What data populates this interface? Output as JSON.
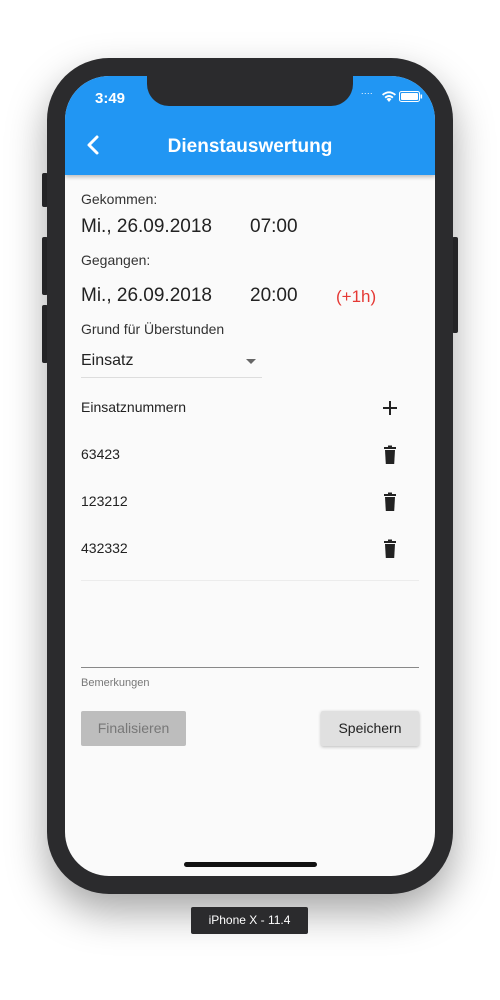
{
  "device": {
    "label": "iPhone X - 11.4"
  },
  "status_bar": {
    "time": "3:49",
    "signal": "....",
    "icons": [
      "wifi-icon",
      "battery-icon"
    ]
  },
  "app_bar": {
    "title": "Dienstauswertung",
    "back_icon": "chevron-left-icon",
    "color": "#2196f3"
  },
  "form": {
    "came_label": "Gekommen:",
    "came_date": "Mi., 26.09.2018",
    "came_time": "07:00",
    "left_label": "Gegangen:",
    "left_date": "Mi., 26.09.2018",
    "left_time": "20:00",
    "overtime": "(+1h)",
    "reason_label": "Grund für Überstunden",
    "reason_value": "Einsatz",
    "mission_numbers_label": "Einsatznummern",
    "mission_numbers": [
      "63423",
      "123212",
      "432332"
    ],
    "remarks_label": "Bemerkungen",
    "remarks_value": ""
  },
  "buttons": {
    "finalize": "Finalisieren",
    "save": "Speichern"
  }
}
